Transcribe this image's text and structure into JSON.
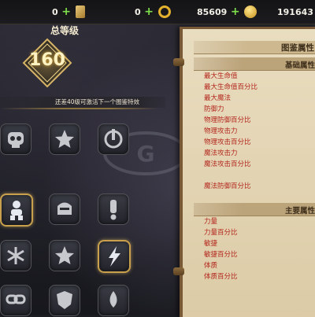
{
  "resources": [
    {
      "name": "scroll",
      "value": "0",
      "icon": "scroll-icon"
    },
    {
      "name": "ring",
      "value": "0",
      "icon": "ring-icon"
    },
    {
      "name": "coin",
      "value": "85609",
      "icon": "coin-icon"
    },
    {
      "name": "gold",
      "value": "191643",
      "icon": "gold-icon"
    }
  ],
  "level": {
    "title": "总等级",
    "value": "160",
    "hint": "还差40级可激活下一个图鉴特效"
  },
  "grid": [
    {
      "row": 1,
      "items": [
        "skull-icon",
        "star-icon",
        "rotate-icon"
      ]
    },
    {
      "row": 2,
      "items": [
        "figure-icon",
        "helmet-icon",
        "exclamation-icon"
      ]
    },
    {
      "row": 3,
      "items": [
        "snowflake-icon",
        "star-icon",
        "lightning-icon"
      ]
    },
    {
      "row": 4,
      "items": [
        "link-icon",
        "shield-icon",
        "drop-icon"
      ]
    }
  ],
  "book": {
    "title": "图鉴属性",
    "basic_section": "基础属性",
    "basic_attrs": [
      "最大生命值",
      "最大生命值百分比",
      "最大魔法",
      "防御力",
      "物理防御百分比",
      "物理攻击力",
      "物理攻击百分比",
      "魔法攻击力",
      "魔法攻击百分比",
      "魔法防御百分比"
    ],
    "main_section": "主要属性",
    "main_attrs": [
      "力量",
      "力量百分比",
      "敏捷",
      "敏捷百分比",
      "体质",
      "体质百分比"
    ]
  },
  "colors": {
    "attr_text": "#b3251c",
    "plus": "#7ee04a",
    "gold_frame": "#c9a04d"
  }
}
